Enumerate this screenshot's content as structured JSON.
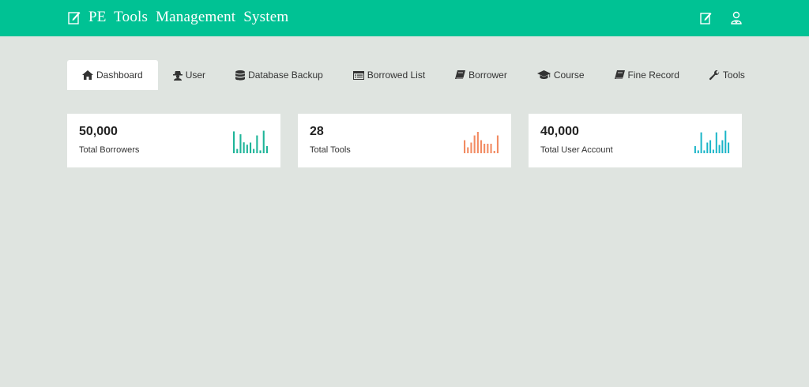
{
  "header": {
    "title": "PE Tools Management System",
    "actions": [
      {
        "icon": "edit-icon"
      },
      {
        "icon": "user-icon"
      }
    ]
  },
  "nav": {
    "tabs": [
      {
        "label": "Dashboard",
        "icon": "home-icon",
        "active": true
      },
      {
        "label": "User",
        "icon": "user-secret-icon"
      },
      {
        "label": "Database Backup",
        "icon": "database-icon"
      },
      {
        "label": "Borrowed List",
        "icon": "list-icon"
      },
      {
        "label": "Borrower",
        "icon": "book-icon"
      },
      {
        "label": "Course",
        "icon": "graduation-cap-icon"
      },
      {
        "label": "Fine Record",
        "icon": "book-icon"
      },
      {
        "label": "Tools",
        "icon": "wrench-icon"
      }
    ]
  },
  "stats": [
    {
      "value": "50,000",
      "label": "Total Borrowers",
      "color": "#1fb599",
      "bars": [
        0.92,
        0.18,
        0.8,
        0.46,
        0.36,
        0.45,
        0.18,
        0.75,
        0.12,
        0.95,
        0.3
      ]
    },
    {
      "value": "28",
      "label": "Total Tools",
      "color": "#f28b62",
      "bars": [
        0.55,
        0.25,
        0.45,
        0.75,
        0.9,
        0.55,
        0.4,
        0.4,
        0.4,
        0.1,
        0.75
      ]
    },
    {
      "value": "40,000",
      "label": "Total User Account",
      "color": "#1ab5c8",
      "bars": [
        0.3,
        0.12,
        0.88,
        0.12,
        0.45,
        0.55,
        0.15,
        0.88,
        0.35,
        0.55,
        0.95,
        0.45
      ]
    }
  ]
}
